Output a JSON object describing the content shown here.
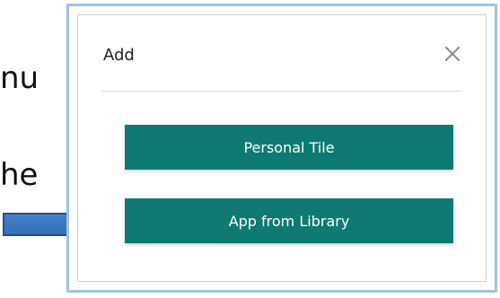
{
  "background": {
    "line1_fragment": "nu",
    "line2_fragment": "he"
  },
  "dialog": {
    "title": "Add",
    "close_icon": "close-icon",
    "buttons": {
      "personal_tile": "Personal Tile",
      "app_from_library": "App from Library"
    }
  },
  "colors": {
    "button_bg": "#0f7a71",
    "dialog_border": "#9dc3e6",
    "arrow_fill": "#2f6fb4"
  },
  "icons": {
    "arrow": "arrow-right-icon"
  }
}
